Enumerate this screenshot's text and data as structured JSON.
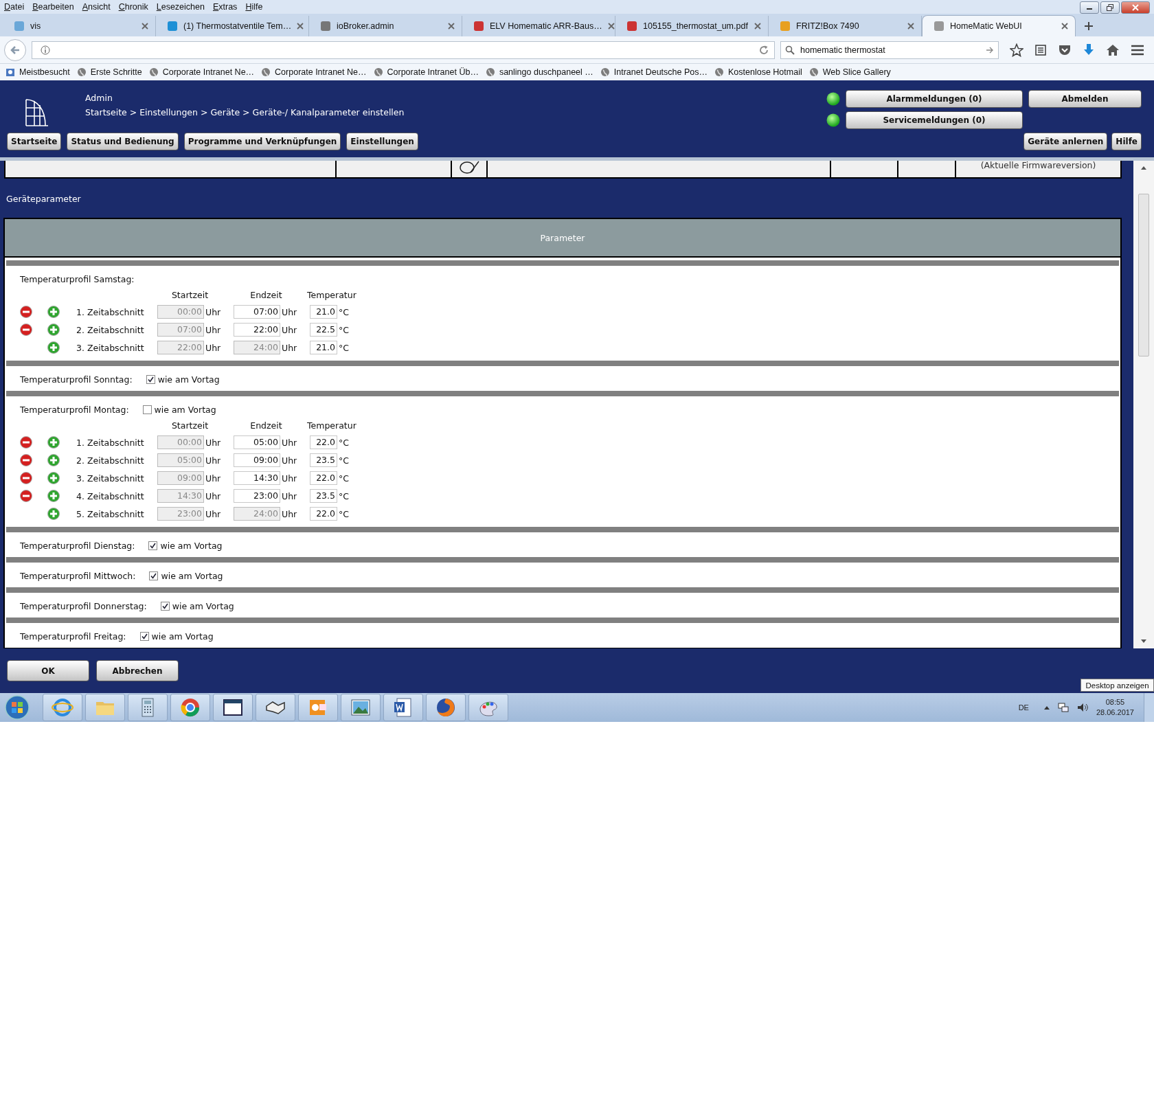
{
  "menu_bar": [
    "Datei",
    "Bearbeiten",
    "Ansicht",
    "Chronik",
    "Lesezeichen",
    "Extras",
    "Hilfe"
  ],
  "tabs": [
    {
      "label": "vis",
      "selected": false
    },
    {
      "label": "(1) Thermostatventile Tem…",
      "selected": false
    },
    {
      "label": "ioBroker.admin",
      "selected": false
    },
    {
      "label": "ELV Homematic ARR-Baus…",
      "selected": false
    },
    {
      "label": "105155_thermostat_um.pdf",
      "selected": false
    },
    {
      "label": "FRITZ!Box 7490",
      "selected": false
    },
    {
      "label": "HomeMatic WebUI",
      "selected": true
    }
  ],
  "search_field": {
    "value": "homematic thermostat"
  },
  "bookmarks": [
    "Meistbesucht",
    "Erste Schritte",
    "Corporate Intranet Ne…",
    "Corporate Intranet Ne…",
    "Corporate Intranet Üb…",
    "sanlingo duschpaneel …",
    "Intranet Deutsche Pos…",
    "Kostenlose Hotmail",
    "Web Slice Gallery"
  ],
  "header": {
    "user": "Admin",
    "breadcrumb": "Startseite > Einstellungen > Geräte > Geräte-/ Kanalparameter einstellen",
    "nav_buttons": [
      "Startseite",
      "Status und Bedienung",
      "Programme und Verknüpfungen",
      "Einstellungen"
    ],
    "message_buttons": [
      "Alarmmeldungen (0)",
      "Servicemeldungen (0)"
    ],
    "logout_button": "Abmelden",
    "right_buttons": [
      "Geräte anlernen",
      "Hilfe"
    ]
  },
  "device_table": {
    "cell_text": "(Aktuelle Firmwareversion)"
  },
  "section_title": "Geräteparameter",
  "parameter_table": {
    "heading": "Parameter",
    "profiles": [
      {
        "label": "Temperaturprofil Samstag:",
        "columns": [
          "Startzeit",
          "Endzeit",
          "Temperatur"
        ],
        "segments": [
          {
            "label": "1. Zeitabschnitt",
            "removable": true,
            "start": "00:00",
            "start_disabled": true,
            "start_unit": "Uhr",
            "end": "07:00",
            "end_disabled": false,
            "end_unit": "Uhr",
            "temperature": "21.0",
            "temp_unit": "°C"
          },
          {
            "label": "2. Zeitabschnitt",
            "removable": true,
            "start": "07:00",
            "start_disabled": true,
            "start_unit": "Uhr",
            "end": "22:00",
            "end_disabled": false,
            "end_unit": "Uhr",
            "temperature": "22.5",
            "temp_unit": "°C"
          },
          {
            "label": "3. Zeitabschnitt",
            "removable": false,
            "start": "22:00",
            "start_disabled": true,
            "start_unit": "Uhr",
            "end": "24:00",
            "end_disabled": true,
            "end_unit": "Uhr",
            "temperature": "21.0",
            "temp_unit": "°C"
          }
        ]
      },
      {
        "label": "Temperaturprofil Sonntag:",
        "same_as_previous": {
          "label": "wie am Vortag",
          "checked": true
        }
      },
      {
        "label": "Temperaturprofil Montag:",
        "same_as_previous": {
          "label": "wie am Vortag",
          "checked": false
        },
        "columns": [
          "Startzeit",
          "Endzeit",
          "Temperatur"
        ],
        "segments": [
          {
            "label": "1. Zeitabschnitt",
            "removable": true,
            "start": "00:00",
            "start_disabled": true,
            "start_unit": "Uhr",
            "end": "05:00",
            "end_disabled": false,
            "end_unit": "Uhr",
            "temperature": "22.0",
            "temp_unit": "°C"
          },
          {
            "label": "2. Zeitabschnitt",
            "removable": true,
            "start": "05:00",
            "start_disabled": true,
            "start_unit": "Uhr",
            "end": "09:00",
            "end_disabled": false,
            "end_unit": "Uhr",
            "temperature": "23.5",
            "temp_unit": "°C"
          },
          {
            "label": "3. Zeitabschnitt",
            "removable": true,
            "start": "09:00",
            "start_disabled": true,
            "start_unit": "Uhr",
            "end": "14:30",
            "end_disabled": false,
            "end_unit": "Uhr",
            "temperature": "22.0",
            "temp_unit": "°C"
          },
          {
            "label": "4. Zeitabschnitt",
            "removable": true,
            "start": "14:30",
            "start_disabled": true,
            "start_unit": "Uhr",
            "end": "23:00",
            "end_disabled": false,
            "end_unit": "Uhr",
            "temperature": "23.5",
            "temp_unit": "°C"
          },
          {
            "label": "5. Zeitabschnitt",
            "removable": false,
            "start": "23:00",
            "start_disabled": true,
            "start_unit": "Uhr",
            "end": "24:00",
            "end_disabled": true,
            "end_unit": "Uhr",
            "temperature": "22.0",
            "temp_unit": "°C"
          }
        ]
      },
      {
        "label": "Temperaturprofil Dienstag:",
        "same_as_previous": {
          "label": "wie am Vortag",
          "checked": true
        }
      },
      {
        "label": "Temperaturprofil Mittwoch:",
        "same_as_previous": {
          "label": "wie am Vortag",
          "checked": true
        }
      },
      {
        "label": "Temperaturprofil Donnerstag:",
        "same_as_previous": {
          "label": "wie am Vortag",
          "checked": true
        }
      },
      {
        "label": "Temperaturprofil Freitag:",
        "same_as_previous": {
          "label": "wie am Vortag",
          "checked": true
        }
      }
    ]
  },
  "footer_buttons": [
    "OK",
    "Abbrechen"
  ],
  "taskbar": {
    "language": "DE",
    "time": "08:55",
    "date": "28.06.2017",
    "tooltip": "Desktop anzeigen"
  }
}
